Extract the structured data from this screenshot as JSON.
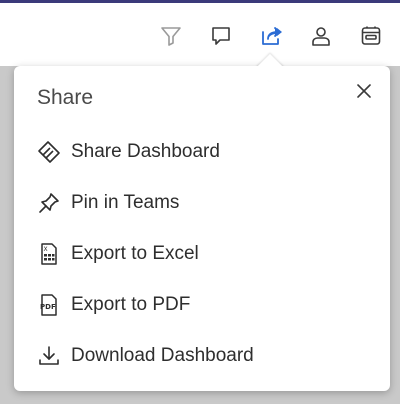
{
  "toolbar": {
    "icons": [
      "filter-icon",
      "comment-icon",
      "share-icon",
      "person-icon",
      "app-icon"
    ],
    "active_color": "#2b6cd4",
    "icon_color": "#3a3a3a",
    "disabled_color": "#9a9a9a"
  },
  "share_panel": {
    "title": "Share",
    "close_icon": "close-icon",
    "items": [
      {
        "label": "Share Dashboard",
        "icon": "share-dashboard-icon"
      },
      {
        "label": "Pin in Teams",
        "icon": "pin-icon"
      },
      {
        "label": "Export to Excel",
        "icon": "excel-icon"
      },
      {
        "label": "Export to PDF",
        "icon": "pdf-icon"
      },
      {
        "label": "Download Dashboard",
        "icon": "download-icon"
      }
    ]
  }
}
